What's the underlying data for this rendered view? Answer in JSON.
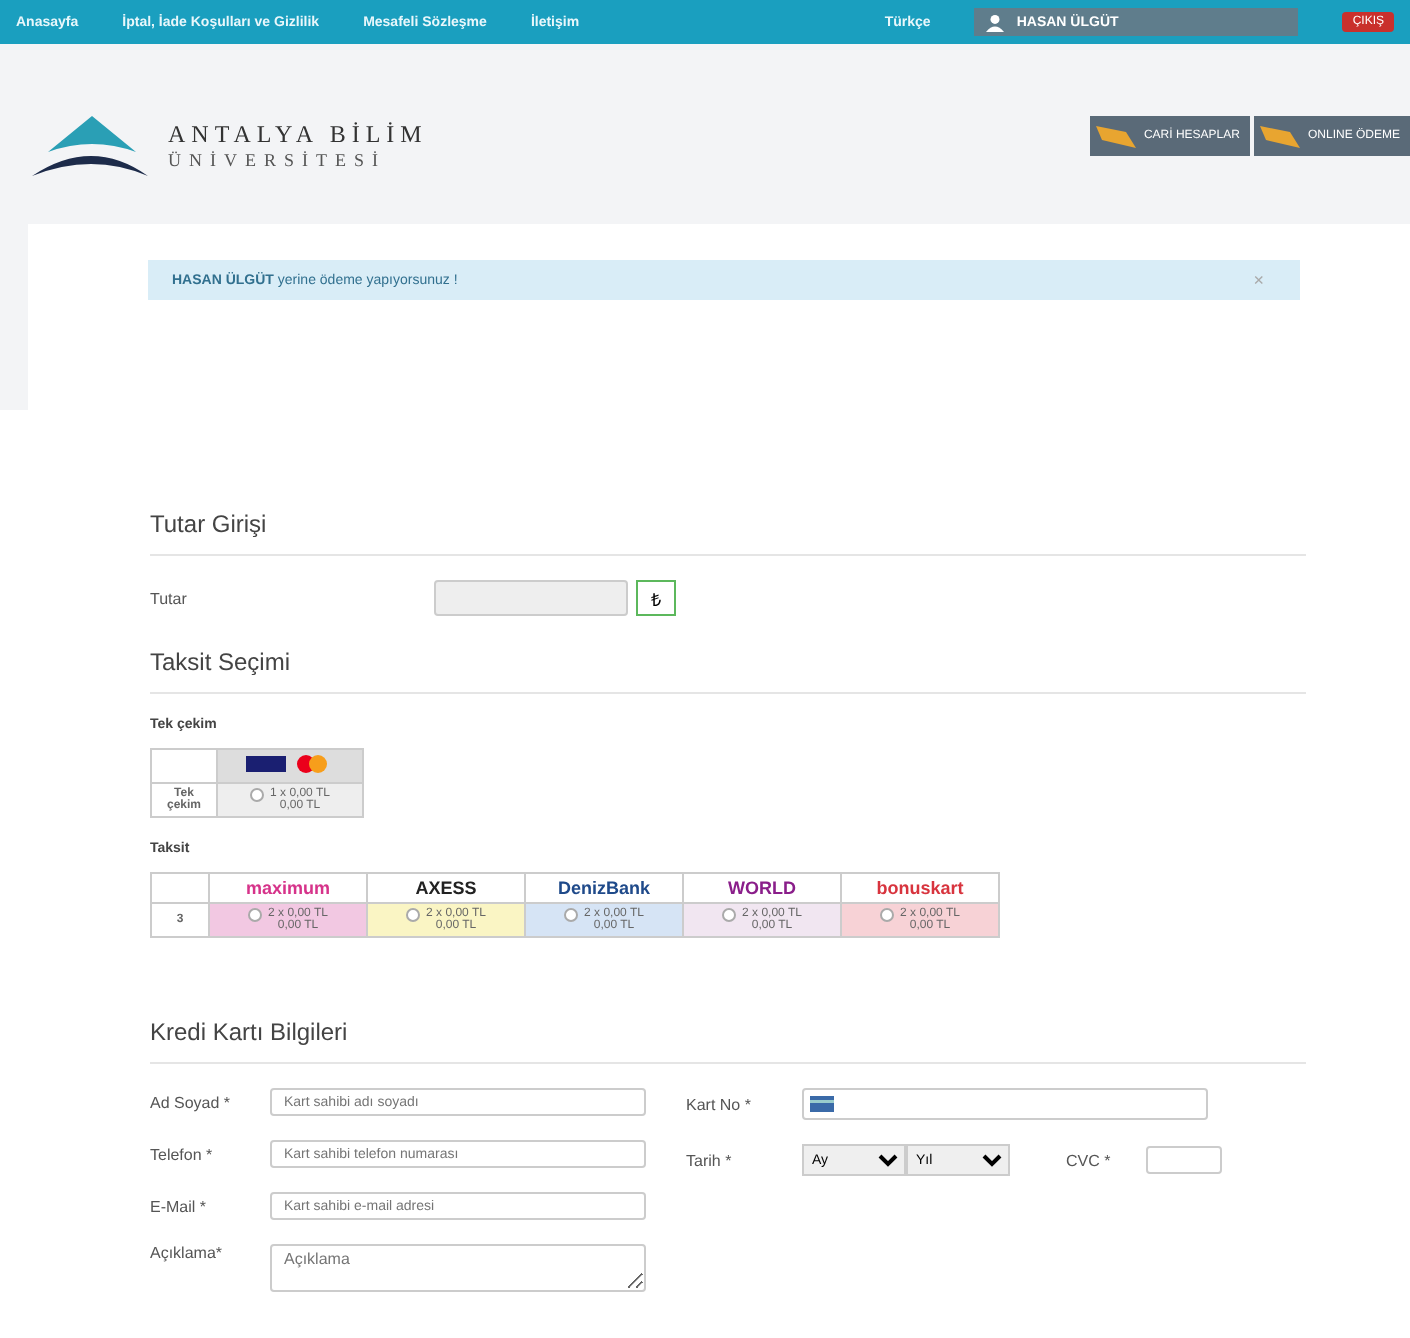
{
  "nav": {
    "links": [
      "Anasayfa",
      "İptal, İade Koşulları ve Gizlilik",
      "Mesafeli Sözleşme",
      "İletişim"
    ],
    "language": "Türkçe",
    "user": "HASAN ÜLGÜT",
    "logout": "ÇIKIŞ"
  },
  "logo": {
    "line1": "ANTALYA BİLİM",
    "line2": "ÜNİVERSİTESİ"
  },
  "header_buttons": [
    "CARİ HESAPLAR",
    "ONLINE ÖDEME"
  ],
  "alert": {
    "name": "HASAN ÜLGÜT",
    "text": " yerine ödeme yapıyorsunuz !",
    "close": "×"
  },
  "amount_section": {
    "title": "Tutar Girişi",
    "label": "Tutar",
    "button": "₺"
  },
  "installment_section": {
    "title": "Taksit Seçimi",
    "single_label": "Tek çekim",
    "single_row": "Tek çekim",
    "single_option": {
      "line1": "1 x 0,00 TL",
      "line2": "0,00 TL",
      "selected": false
    },
    "taksit_label": "Taksit",
    "row_label": "3",
    "cards": [
      {
        "brand": {
          "text": "maximum",
          "color": "#d6338a"
        },
        "color": "#f2c8e2",
        "line1": "2 x 0,00 TL",
        "line2": "0,00 TL",
        "selected": false
      },
      {
        "brand": {
          "text": "AXESS",
          "color": "#222222"
        },
        "color": "#faf5c4",
        "line1": "2 x 0,00 TL",
        "line2": "0,00 TL",
        "selected": false
      },
      {
        "brand": {
          "text": "DenizBank",
          "color": "#1f4a8a"
        },
        "color": "#d6e4f5",
        "line1": "2 x 0,00 TL",
        "line2": "0,00 TL",
        "selected": false
      },
      {
        "brand": {
          "text": "WORLD",
          "color": "#8a1e8a"
        },
        "color": "#f1e6f1",
        "line1": "2 x 0,00 TL",
        "line2": "0,00 TL",
        "selected": false
      },
      {
        "brand": {
          "text": "bonuskart",
          "color": "#d8343e"
        },
        "color": "#f7d2d6",
        "line1": "2 x 0,00 TL",
        "line2": "0,00 TL",
        "selected": false
      }
    ]
  },
  "card_section": {
    "title": "Kredi Kartı Bilgileri",
    "name": {
      "label": "Ad Soyad *",
      "placeholder": "Kart sahibi adı soyadı"
    },
    "phone": {
      "label": "Telefon *",
      "placeholder": "Kart sahibi telefon numarası"
    },
    "email": {
      "label": "E-Mail *",
      "placeholder": "Kart sahibi e-mail adresi"
    },
    "note": {
      "label": "Açıklama*",
      "placeholder": "Açıklama"
    },
    "card_no": {
      "label": "Kart No *"
    },
    "date": {
      "label": "Tarih *",
      "month": "Ay",
      "year": "Yıl"
    },
    "cvc": {
      "label": "CVC *"
    }
  }
}
